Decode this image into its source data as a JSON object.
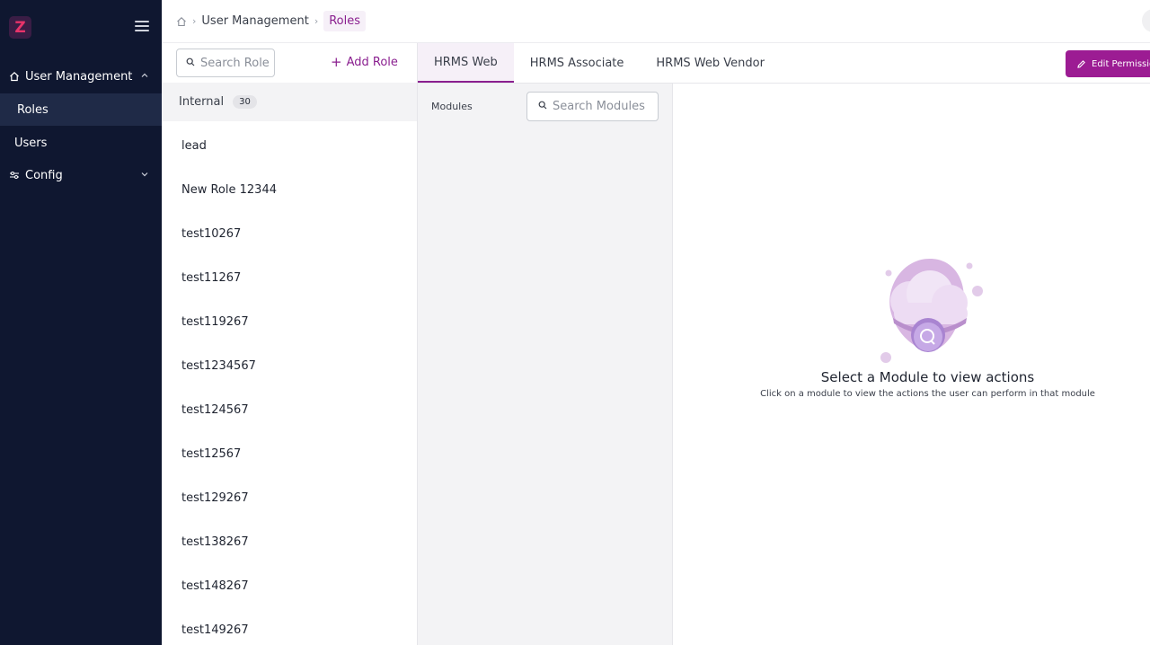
{
  "app": {
    "logo_letter": "Z",
    "accent": "#8a1f8f",
    "sidebar_bg": "#0f1730"
  },
  "sidebar": {
    "items": [
      {
        "label": "User Management",
        "icon": "home-icon"
      },
      {
        "label": "Roles"
      },
      {
        "label": "Users"
      },
      {
        "label": "Config",
        "icon": "settings-sliders-icon"
      }
    ]
  },
  "breadcrumb": {
    "parent": "User Management",
    "current": "Roles"
  },
  "roles": {
    "search_placeholder": "Search Role",
    "add_label": "Add Role",
    "group": {
      "name": "Internal",
      "count": "30"
    },
    "items": [
      "lead",
      "New Role 12344",
      "test10267",
      "test11267",
      "test119267",
      "test1234567",
      "test124567",
      "test12567",
      "test129267",
      "test138267",
      "test148267",
      "test149267"
    ]
  },
  "tabs": [
    {
      "label": "HRMS Web",
      "active": true
    },
    {
      "label": "HRMS Associate",
      "active": false
    },
    {
      "label": "HRMS Web Vendor",
      "active": false
    }
  ],
  "edit_permissions_label": "Edit Permissio",
  "modules": {
    "label": "Modules",
    "search_placeholder": "Search Modules"
  },
  "empty_state": {
    "title": "Select a Module to view actions",
    "subtitle": "Click on a module to view the actions the user can perform in that module"
  }
}
